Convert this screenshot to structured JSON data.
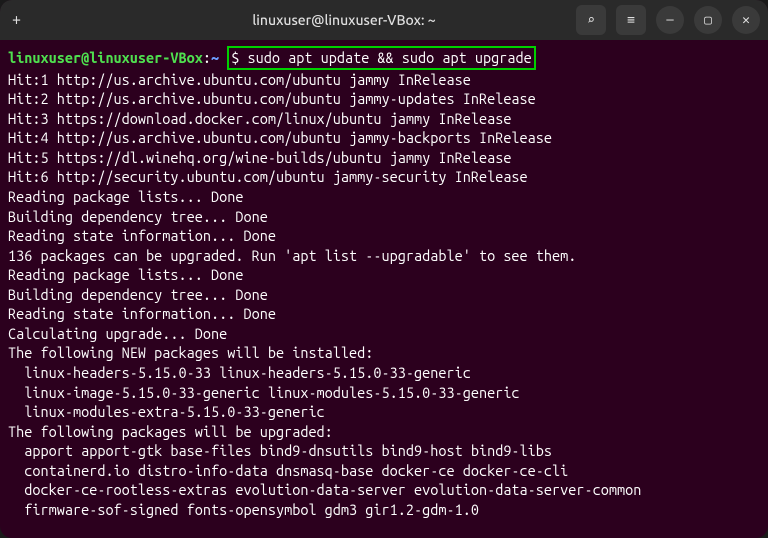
{
  "titlebar": {
    "title": "linuxuser@linuxuser-VBox: ~",
    "newTabIcon": "+",
    "searchIcon": "⌕",
    "menuIcon": "≡",
    "minimizeIcon": "—",
    "maximizeIcon": "▢",
    "closeIcon": "✕"
  },
  "prompt": {
    "userHost": "linuxuser@linuxuser-VBox",
    "colon1": ":",
    "path": "~",
    "dollar": "$ ",
    "command": "sudo apt update && sudo apt upgrade"
  },
  "output": [
    "Hit:1 http://us.archive.ubuntu.com/ubuntu jammy InRelease",
    "Hit:2 http://us.archive.ubuntu.com/ubuntu jammy-updates InRelease",
    "Hit:3 https://download.docker.com/linux/ubuntu jammy InRelease",
    "Hit:4 http://us.archive.ubuntu.com/ubuntu jammy-backports InRelease",
    "Hit:5 https://dl.winehq.org/wine-builds/ubuntu jammy InRelease",
    "Hit:6 http://security.ubuntu.com/ubuntu jammy-security InRelease",
    "Reading package lists... Done",
    "Building dependency tree... Done",
    "Reading state information... Done",
    "136 packages can be upgraded. Run 'apt list --upgradable' to see them.",
    "Reading package lists... Done",
    "Building dependency tree... Done",
    "Reading state information... Done",
    "Calculating upgrade... Done",
    "The following NEW packages will be installed:",
    "  linux-headers-5.15.0-33 linux-headers-5.15.0-33-generic",
    "  linux-image-5.15.0-33-generic linux-modules-5.15.0-33-generic",
    "  linux-modules-extra-5.15.0-33-generic",
    "The following packages will be upgraded:",
    "  apport apport-gtk base-files bind9-dnsutils bind9-host bind9-libs",
    "  containerd.io distro-info-data dnsmasq-base docker-ce docker-ce-cli",
    "  docker-ce-rootless-extras evolution-data-server evolution-data-server-common",
    "  firmware-sof-signed fonts-opensymbol gdm3 gir1.2-gdm-1.0"
  ]
}
